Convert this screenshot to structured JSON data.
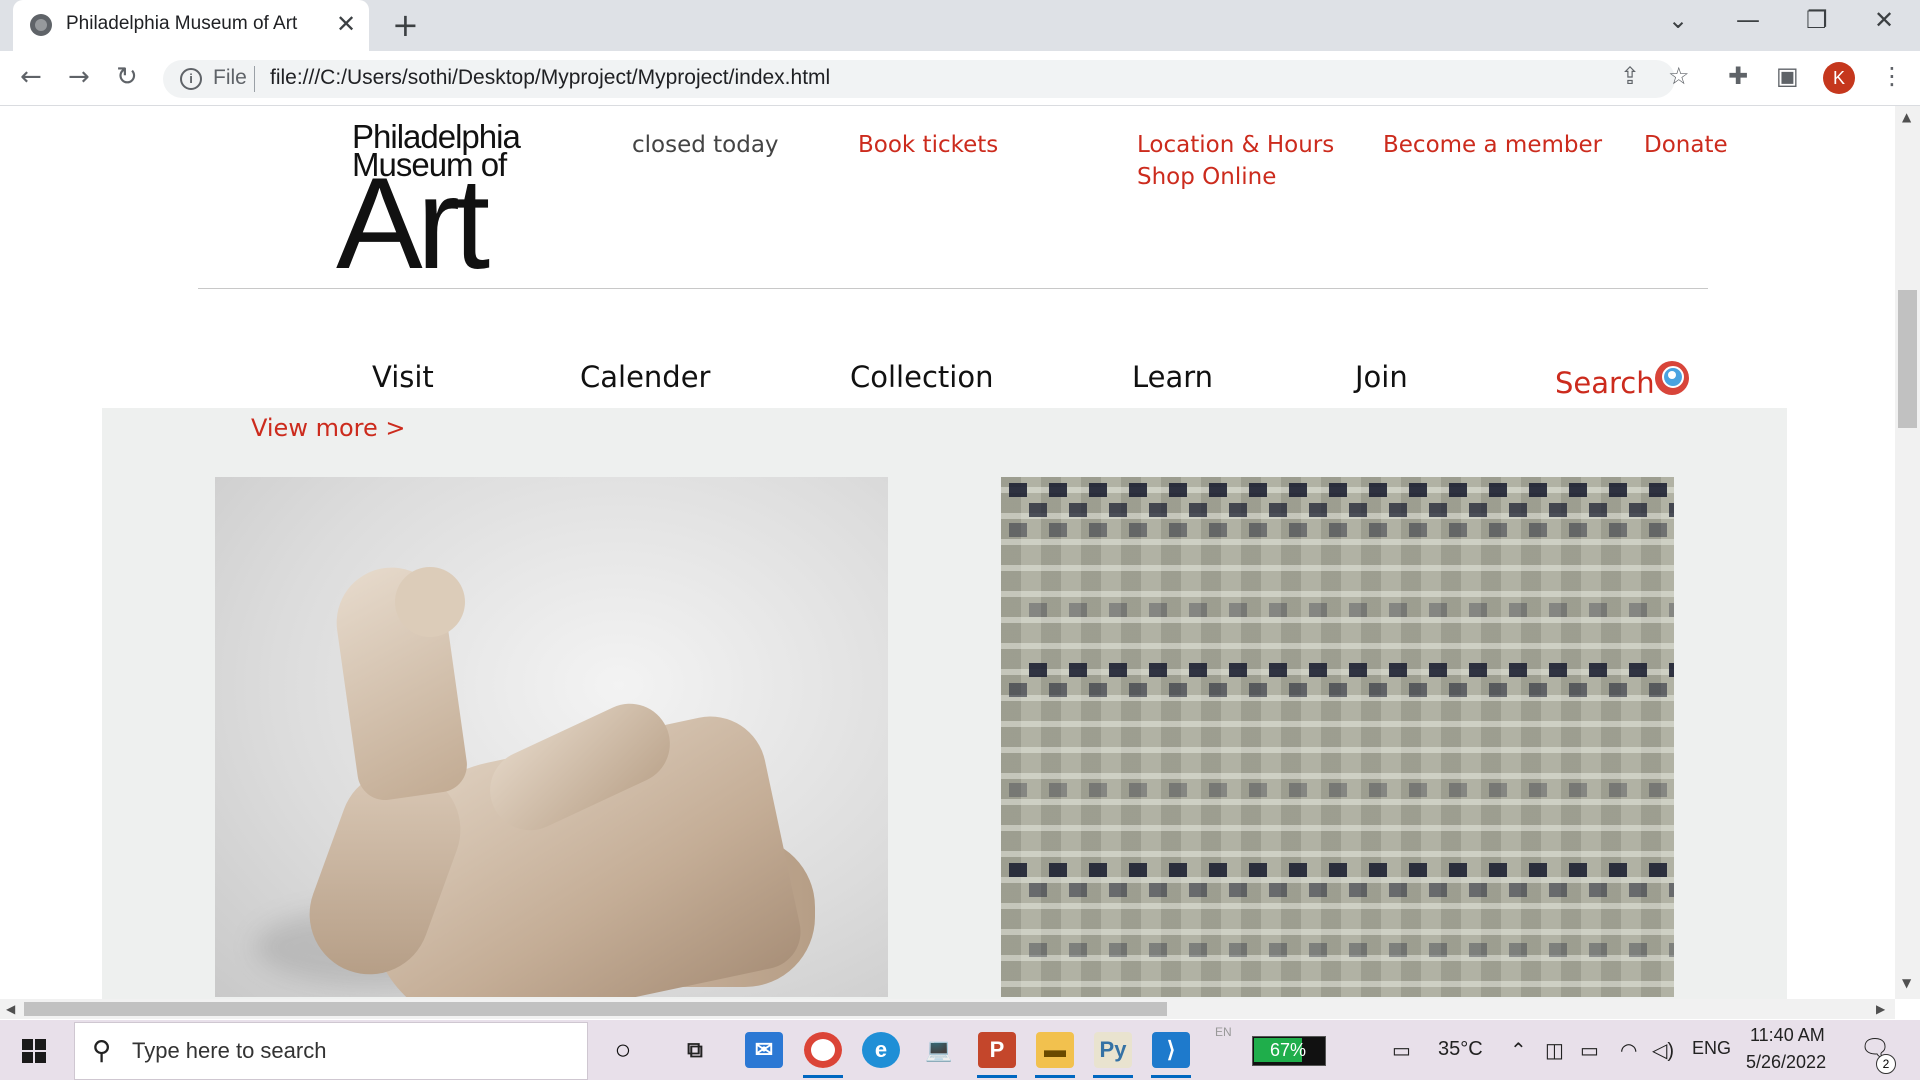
{
  "browser": {
    "tab_title": "Philadelphia Museum of Art",
    "omnibox_scheme": "File",
    "url": "file:///C:/Users/sothi/Desktop/Myproject/Myproject/index.html",
    "profile_initial": "K"
  },
  "site": {
    "logo": {
      "line1": "Philadelphia",
      "line2": "Museum of",
      "line3": "Art"
    },
    "utility_nav": {
      "status": "closed today",
      "book_tickets": "Book tickets",
      "location_hours": "Location & Hours",
      "shop_online": "Shop Online",
      "become_member": "Become a member",
      "donate": "Donate"
    },
    "main_nav": [
      "Visit",
      "Calender",
      "Collection",
      "Learn",
      "Join"
    ],
    "search_label": "Search",
    "view_more": "View more >",
    "accent_color": "#cc2b1d"
  },
  "taskbar": {
    "search_placeholder": "Type here to search",
    "battery_percent": "67%",
    "ime_indicator": "EN",
    "temperature": "35°C",
    "language": "ENG",
    "time": "11:40 AM",
    "date": "5/26/2022",
    "notification_count": "2"
  }
}
